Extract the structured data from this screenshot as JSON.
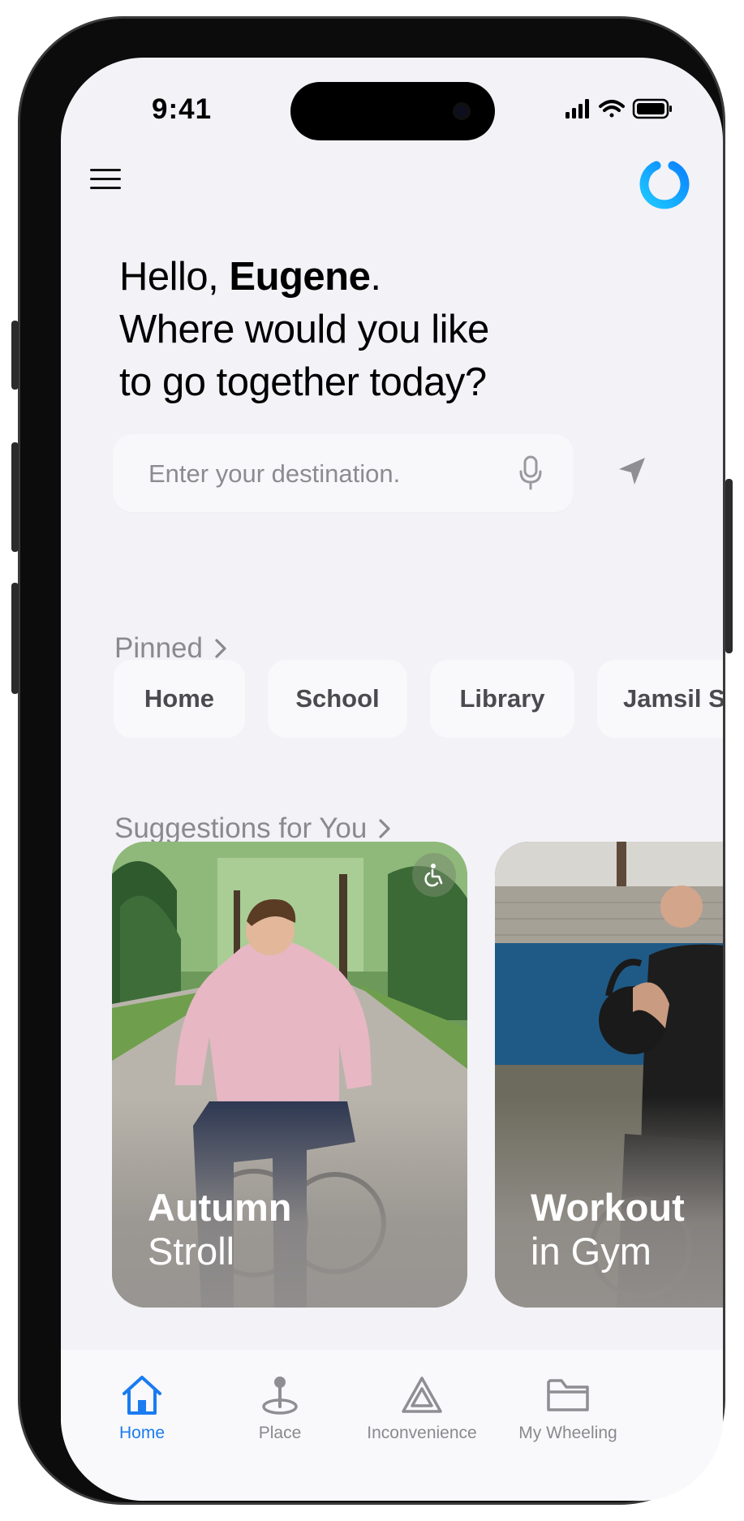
{
  "status_bar": {
    "time": "9:41"
  },
  "header": {
    "menu_icon": "hamburger-menu-icon",
    "logo_icon": "app-ring-logo",
    "accent": "#0a84ff"
  },
  "greeting": {
    "hello": "Hello, ",
    "name": "Eugene",
    "period": ".",
    "line2": "Where would you like",
    "line3": "to go together today?"
  },
  "search": {
    "placeholder": "Enter your destination.",
    "value": "",
    "mic_icon": "microphone-icon",
    "location_icon": "location-arrow-icon"
  },
  "pinned": {
    "title": "Pinned",
    "items": [
      {
        "label": "Home"
      },
      {
        "label": "School"
      },
      {
        "label": "Library"
      },
      {
        "label": "Jamsil S"
      }
    ]
  },
  "suggestions": {
    "title": "Suggestions for You",
    "cards": [
      {
        "title": "Autumn",
        "subtitle": "Stroll",
        "badge_icon": "wheelchair-icon"
      },
      {
        "title": "Workout",
        "subtitle": "in Gym"
      }
    ]
  },
  "tabbar": {
    "tabs": [
      {
        "label": "Home",
        "icon": "home-icon",
        "active": true
      },
      {
        "label": "Place",
        "icon": "map-pin-icon",
        "active": false
      },
      {
        "label": "Inconvenience",
        "icon": "warning-triangle-icon",
        "active": false
      },
      {
        "label": "My Wheeling",
        "icon": "folder-icon",
        "active": false
      }
    ]
  }
}
